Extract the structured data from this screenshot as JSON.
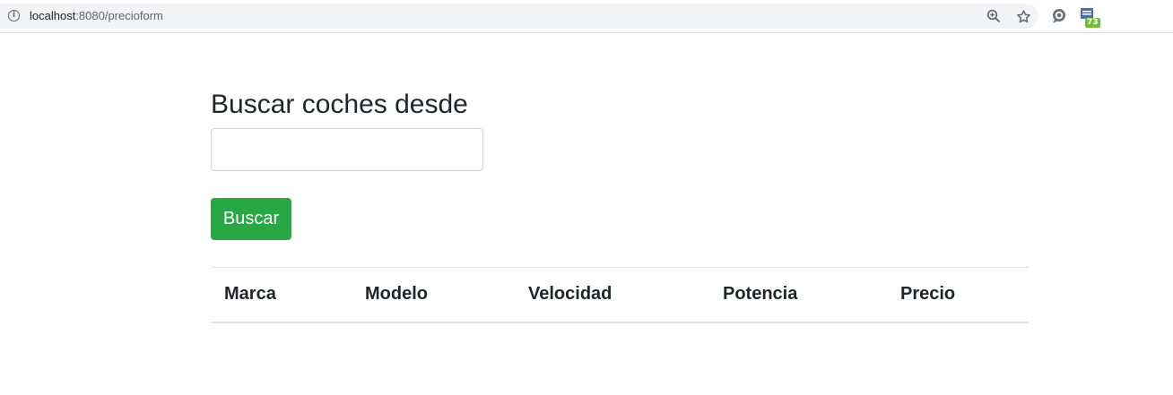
{
  "browser": {
    "url_host": "localhost",
    "url_path": ":8080/precioform",
    "extension_badge": "73"
  },
  "page": {
    "title": "Buscar coches desde",
    "search_input_value": "",
    "search_button_label": "Buscar"
  },
  "table": {
    "columns": [
      "Marca",
      "Modelo",
      "Velocidad",
      "Potencia",
      "Precio"
    ],
    "rows": []
  },
  "colors": {
    "accent_button": "#28a745",
    "text": "#212529",
    "border": "#dee2e6",
    "extension_badge": "#6fbf3b"
  },
  "icons": [
    "info-icon",
    "zoom-icon",
    "star-icon",
    "chat-extension-icon",
    "sheet-extension-icon"
  ]
}
